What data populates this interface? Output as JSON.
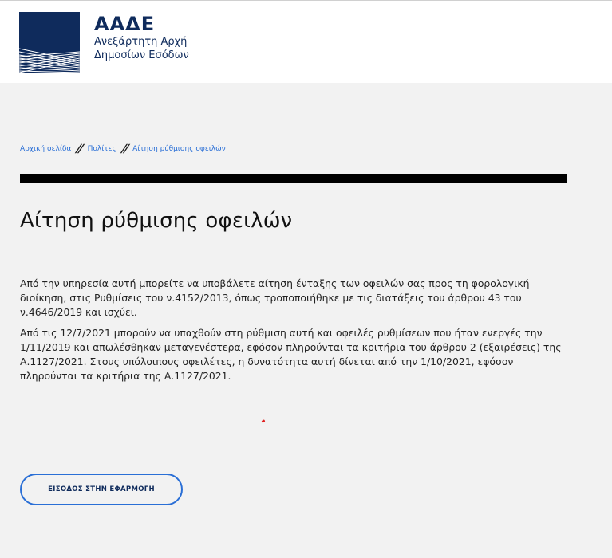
{
  "header": {
    "brand_title": "ΑΑΔΕ",
    "brand_subtitle_line1": "Ανεξάρτητη Αρχή",
    "brand_subtitle_line2": "Δημοσίων Εσόδων"
  },
  "breadcrumb": {
    "items": [
      {
        "label": "Αρχική σελίδα"
      },
      {
        "label": "Πολίτες"
      },
      {
        "label": "Αίτηση ρύθμισης οφειλών"
      }
    ],
    "separator": "//"
  },
  "page": {
    "title": "Αίτηση ρύθμισης οφειλών",
    "paragraphs": [
      "Από την υπηρεσία αυτή μπορείτε να υποβάλετε αίτηση ένταξης των οφειλών σας προς τη φορολογική διοίκηση, στις Ρυθμίσεις του ν.4152/2013, όπως τροποποιήθηκε με τις διατάξεις του άρθρου 43 του ν.4646/2019 και ισχύει.",
      "Από τις 12/7/2021 μπορούν να υπαχθούν στη ρύθμιση αυτή και οφειλές ρυθμίσεων που ήταν ενεργές την 1/11/2019 και απωλέσθηκαν μεταγενέστερα, εφόσον πληρούνται τα κριτήρια του άρθρου 2 (εξαιρέσεις) της Α.1127/2021. Στους υπόλοιπους οφειλέτες, η δυνατότητα αυτή δίνεται από την 1/10/2021, εφόσον πληρούνται τα κριτήρια της Α.1127/2021."
    ],
    "entry_button_label": "ΕΙΣΟΔΟΣ ΣΤΗΝ ΕΦΑΡΜΟΓΗ"
  },
  "colors": {
    "brand_navy": "#0f2b5c",
    "link_blue": "#2a6fd6",
    "page_bg": "#f2f2f2"
  }
}
